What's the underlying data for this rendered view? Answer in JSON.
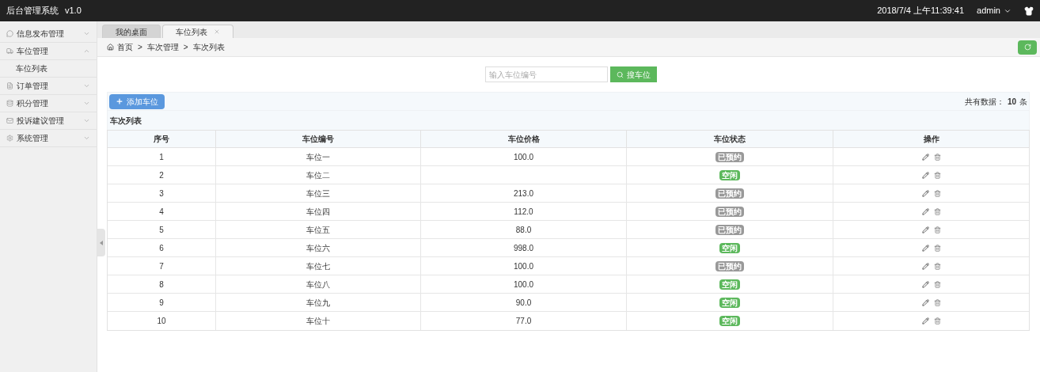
{
  "header": {
    "title": "后台管理系统",
    "version": "v1.0",
    "datetime": "2018/7/4 上午11:39:41",
    "user": "admin"
  },
  "sidebar": {
    "items": [
      {
        "label": "信息发布管理",
        "expanded": false
      },
      {
        "label": "车位管理",
        "expanded": true,
        "children": [
          {
            "label": "车位列表"
          }
        ]
      },
      {
        "label": "订单管理",
        "expanded": false
      },
      {
        "label": "积分管理",
        "expanded": false
      },
      {
        "label": "投诉建议管理",
        "expanded": false
      },
      {
        "label": "系统管理",
        "expanded": false
      }
    ]
  },
  "tabs": [
    {
      "label": "我的桌面",
      "selected": false,
      "closable": false
    },
    {
      "label": "车位列表",
      "selected": true,
      "closable": true
    }
  ],
  "breadcrumb": {
    "separator": ">",
    "items": [
      "首页",
      "车次管理",
      "车次列表"
    ]
  },
  "search": {
    "placeholder": "输入车位编号",
    "button": "搜车位"
  },
  "toolbar": {
    "add_button": "添加车位",
    "total_label": "共有数据：",
    "total": "10",
    "unit": "条"
  },
  "table": {
    "caption": "车次列表",
    "columns": [
      "序号",
      "车位编号",
      "车位价格",
      "车位状态",
      "操作"
    ],
    "rows": [
      {
        "no": "1",
        "name": "车位一",
        "price": "100.0",
        "status": {
          "text": "已预约",
          "kind": "booked"
        }
      },
      {
        "no": "2",
        "name": "车位二",
        "status": {
          "text": "空闲",
          "kind": "free"
        }
      },
      {
        "no": "3",
        "name": "车位三",
        "price": "213.0",
        "status": {
          "text": "已预约",
          "kind": "booked"
        }
      },
      {
        "no": "4",
        "name": "车位四",
        "price": "112.0",
        "status": {
          "text": "已预约",
          "kind": "booked"
        }
      },
      {
        "no": "5",
        "name": "车位五",
        "price": "88.0",
        "status": {
          "text": "已预约",
          "kind": "booked"
        }
      },
      {
        "no": "6",
        "name": "车位六",
        "price": "998.0",
        "status": {
          "text": "空闲",
          "kind": "free"
        }
      },
      {
        "no": "7",
        "name": "车位七",
        "price": "100.0",
        "status": {
          "text": "已预约",
          "kind": "booked"
        }
      },
      {
        "no": "8",
        "name": "车位八",
        "price": "100.0",
        "status": {
          "text": "空闲",
          "kind": "free"
        }
      },
      {
        "no": "9",
        "name": "车位九",
        "price": "90.0",
        "status": {
          "text": "空闲",
          "kind": "free"
        }
      },
      {
        "no": "10",
        "name": "车位十",
        "price": "77.0",
        "status": {
          "text": "空闲",
          "kind": "free"
        }
      }
    ]
  }
}
